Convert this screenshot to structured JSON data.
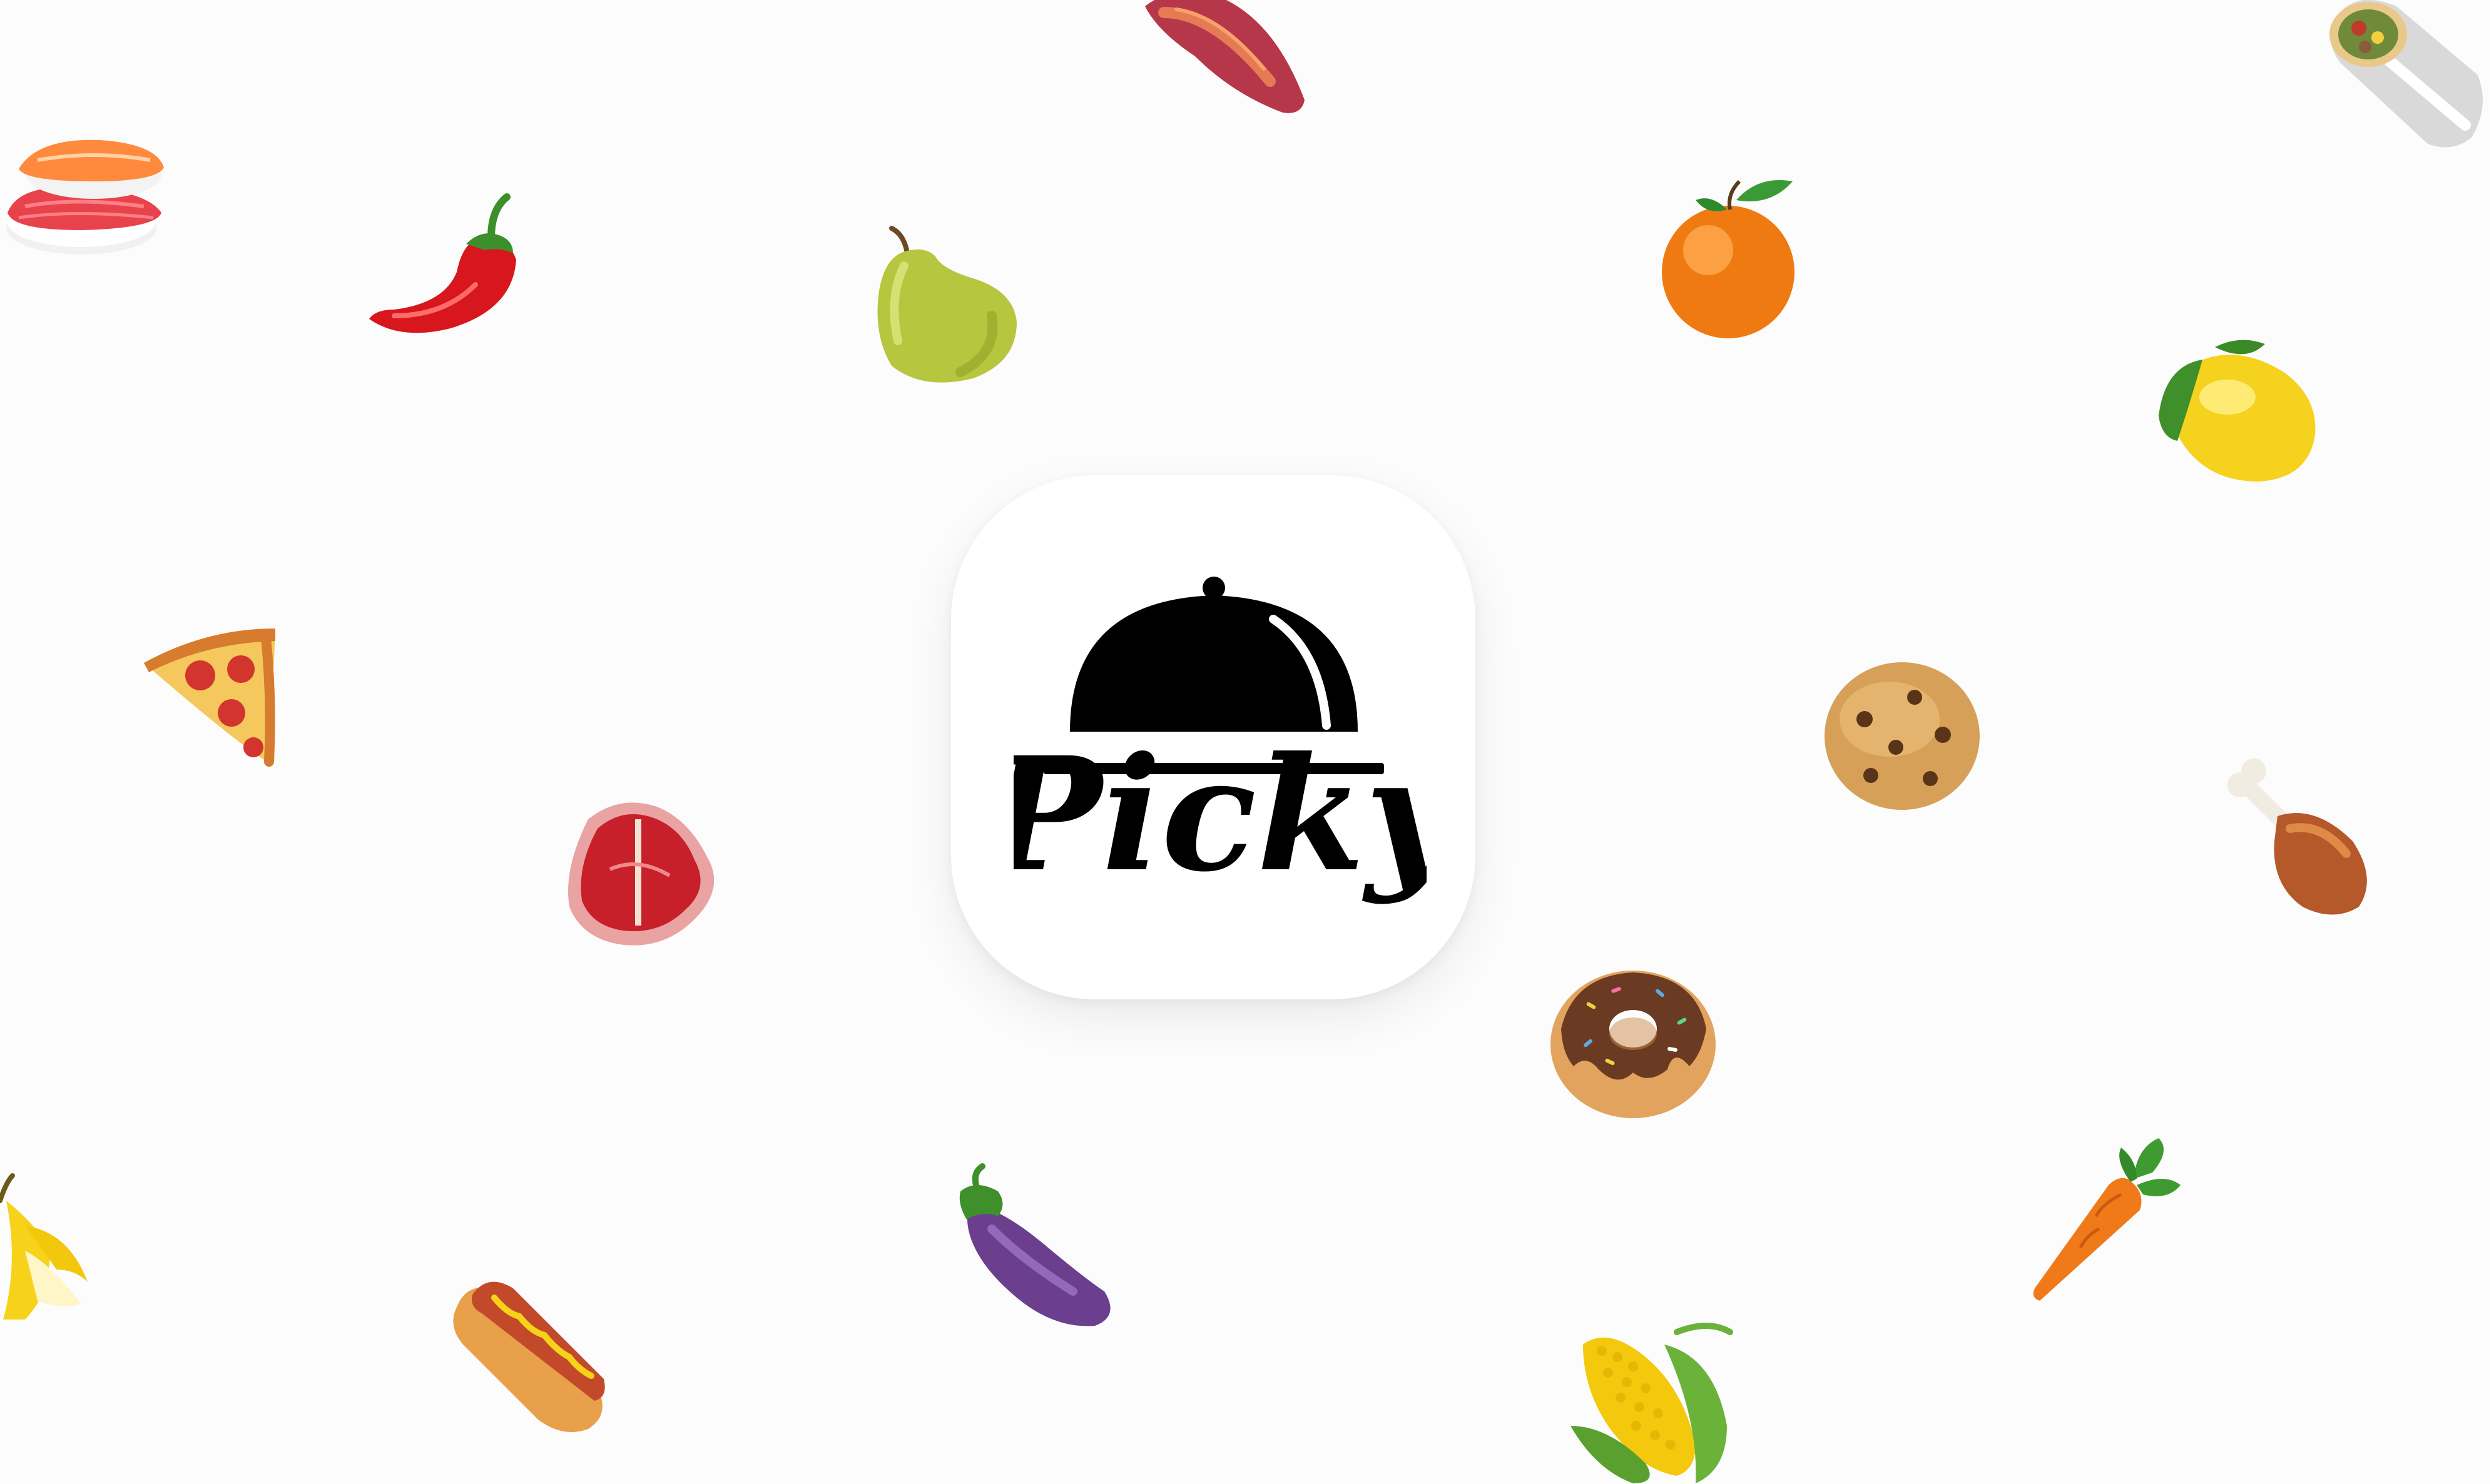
{
  "app": {
    "name": "Picky",
    "icon_background": "#ffffff",
    "ink_color": "#000000"
  },
  "background": {
    "color": "#fcfcfc"
  },
  "foods": [
    {
      "id": "sushi",
      "icon": "sushi-icon"
    },
    {
      "id": "chili",
      "icon": "hot-pepper-icon"
    },
    {
      "id": "sweet-potato",
      "icon": "sweet-potato-icon"
    },
    {
      "id": "pear",
      "icon": "pear-icon"
    },
    {
      "id": "orange",
      "icon": "orange-icon"
    },
    {
      "id": "burrito",
      "icon": "burrito-icon"
    },
    {
      "id": "lemon",
      "icon": "lemon-icon"
    },
    {
      "id": "pizza",
      "icon": "pizza-icon"
    },
    {
      "id": "steak",
      "icon": "steak-icon"
    },
    {
      "id": "cookie",
      "icon": "cookie-icon"
    },
    {
      "id": "drumstick",
      "icon": "drumstick-icon"
    },
    {
      "id": "donut",
      "icon": "donut-icon"
    },
    {
      "id": "carrot",
      "icon": "carrot-icon"
    },
    {
      "id": "banana",
      "icon": "banana-icon"
    },
    {
      "id": "hotdog",
      "icon": "hotdog-icon"
    },
    {
      "id": "eggplant",
      "icon": "eggplant-icon"
    },
    {
      "id": "corn",
      "icon": "corn-icon"
    }
  ]
}
